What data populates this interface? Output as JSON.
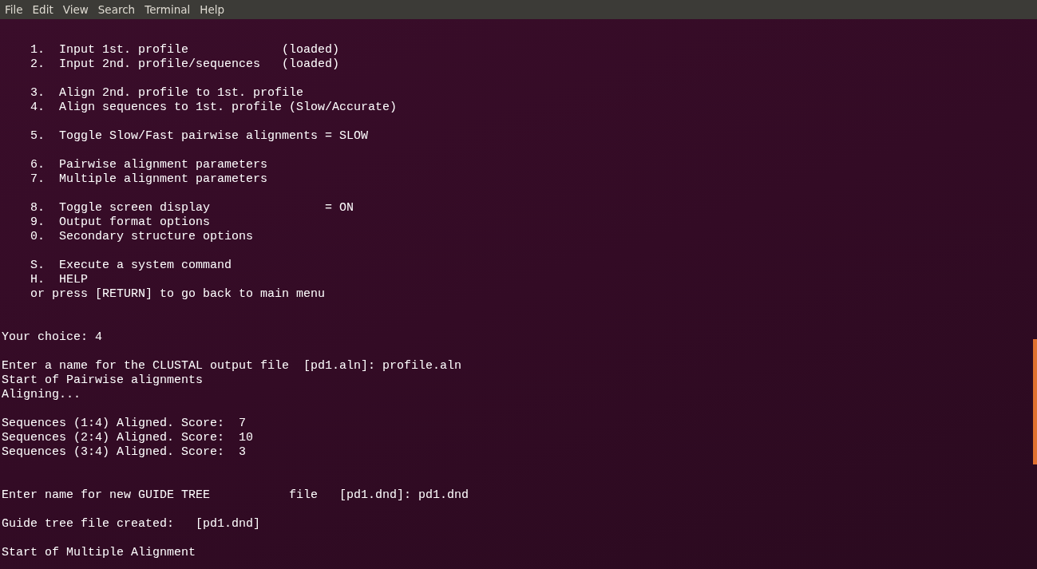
{
  "menu_bar": [
    "File",
    "Edit",
    "View",
    "Search",
    "Terminal",
    "Help"
  ],
  "terminal": {
    "blocks": [
      {
        "kind": "after_one_blank",
        "lines": [
          "    1.  Input 1st. profile             (loaded)",
          "    2.  Input 2nd. profile/sequences   (loaded)"
        ]
      },
      {
        "kind": "after_one_blank",
        "lines": [
          "    3.  Align 2nd. profile to 1st. profile",
          "    4.  Align sequences to 1st. profile (Slow/Accurate)"
        ]
      },
      {
        "kind": "after_one_blank",
        "lines": [
          "    5.  Toggle Slow/Fast pairwise alignments = SLOW"
        ]
      },
      {
        "kind": "after_one_blank",
        "lines": [
          "    6.  Pairwise alignment parameters",
          "    7.  Multiple alignment parameters"
        ]
      },
      {
        "kind": "after_one_blank",
        "lines": [
          "    8.  Toggle screen display                = ON",
          "    9.  Output format options",
          "    0.  Secondary structure options"
        ]
      },
      {
        "kind": "after_one_blank",
        "lines": [
          "    S.  Execute a system command",
          "    H.  HELP",
          "    or press [RETURN] to go back to main menu"
        ]
      },
      {
        "kind": "after_two_blanks",
        "lines": [
          "Your choice: 4"
        ]
      },
      {
        "kind": "after_one_blank",
        "lines": [
          "Enter a name for the CLUSTAL output file  [pd1.aln]: profile.aln",
          "Start of Pairwise alignments",
          "Aligning..."
        ]
      },
      {
        "kind": "after_one_blank",
        "lines": [
          "Sequences (1:4) Aligned. Score:  7",
          "Sequences (2:4) Aligned. Score:  10",
          "Sequences (3:4) Aligned. Score:  3"
        ]
      },
      {
        "kind": "after_two_blanks",
        "lines": [
          "Enter name for new GUIDE TREE           file   [pd1.dnd]: pd1.dnd"
        ]
      },
      {
        "kind": "after_one_blank",
        "lines": [
          "Guide tree file created:   [pd1.dnd]"
        ]
      },
      {
        "kind": "after_one_blank",
        "lines": [
          "Start of Multiple Alignment"
        ]
      }
    ]
  }
}
